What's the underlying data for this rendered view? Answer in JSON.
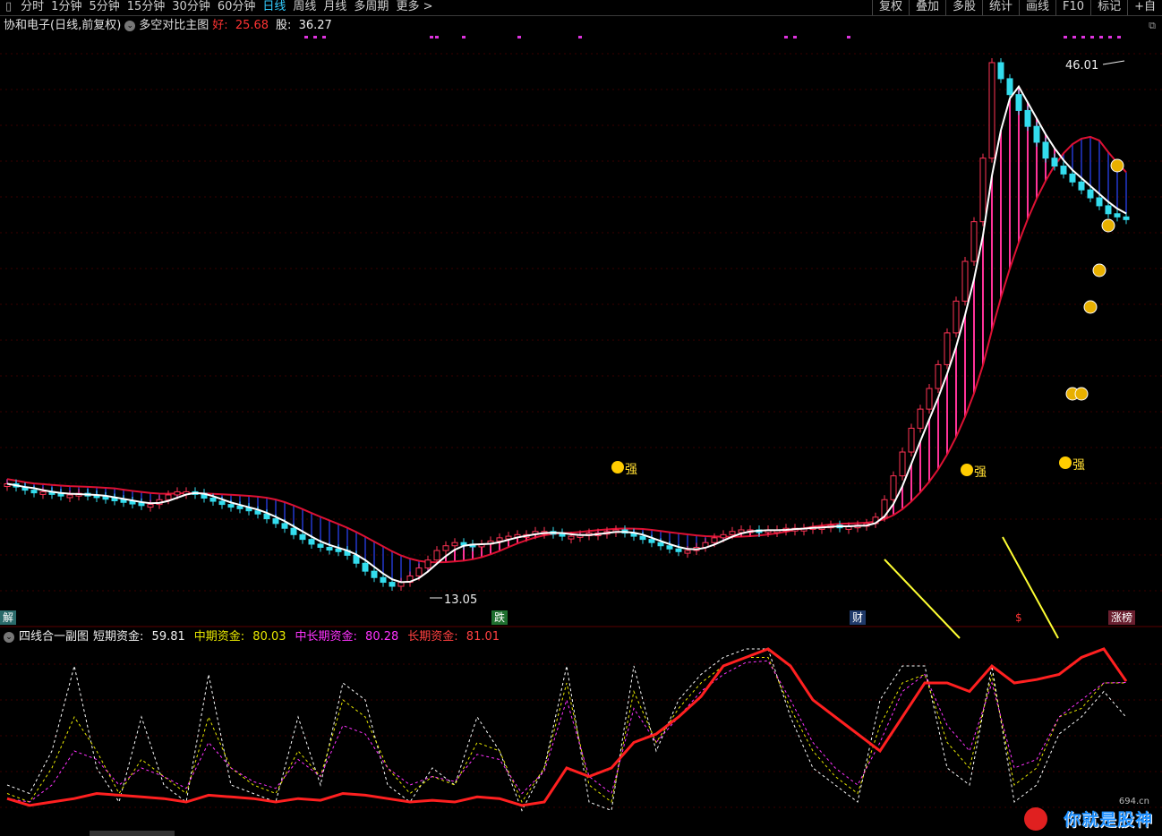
{
  "toolbar": {
    "tabs": [
      "分时",
      "1分钟",
      "5分钟",
      "15分钟",
      "30分钟",
      "60分钟",
      "日线",
      "周线",
      "月线",
      "多周期",
      "更多 >"
    ],
    "active_tab": "日线",
    "right_buttons": [
      "复权",
      "叠加",
      "多股",
      "统计",
      "画线",
      "F10",
      "标记",
      "+自"
    ]
  },
  "main_header": {
    "stock": "协和电子(日线,前复权)",
    "indicator": "多空对比主图",
    "good_label": "好:",
    "good_value": "25.68",
    "stock_label": "股:",
    "stock_value": "36.27"
  },
  "sub_header": {
    "indicator": "四线合一副图",
    "short_label": "短期资金:",
    "short_value": "59.81",
    "mid_label": "中期资金:",
    "mid_value": "80.03",
    "midlong_label": "中长期资金:",
    "midlong_value": "80.28",
    "long_label": "长期资金:",
    "long_value": "81.01"
  },
  "event_labels": {
    "left": "解",
    "die": "跌",
    "cai": "财",
    "dollar": "$",
    "zhang": "涨榜"
  },
  "chart_labels": {
    "high": "46.01",
    "low": "13.05",
    "strong": "强"
  },
  "watermark": {
    "site": "694.cn",
    "text": "你就是股神"
  },
  "colors": {
    "bull": "#ff3355",
    "bear": "#33ddee",
    "fill_bear": "#1a2a9a",
    "fill_bull": "#ff3399",
    "ma": "#ffffff",
    "resist": "#dd1133",
    "short": "#ffffff",
    "mid": "#e8e800",
    "midlong": "#ff33ff",
    "long": "#ff2020"
  },
  "chart_data": [
    {
      "type": "candlestick",
      "title": "多空对比主图",
      "series": [
        {
          "name": "价格K线",
          "x": [
            0,
            10,
            20,
            30,
            40,
            50,
            60,
            70,
            80,
            90,
            100,
            110,
            120,
            130,
            140,
            150,
            160,
            170,
            180,
            190,
            200,
            210,
            220,
            230,
            240,
            250,
            260,
            270,
            280,
            290,
            300,
            310,
            320,
            330,
            340,
            350,
            360,
            370,
            380,
            390,
            400,
            410,
            420,
            430,
            440,
            450,
            460,
            470,
            480,
            490,
            500,
            510,
            520,
            530,
            540,
            550,
            560,
            570,
            580,
            590,
            600,
            610,
            620,
            630,
            640,
            650,
            660,
            670,
            680,
            690,
            700,
            710,
            720,
            730,
            740,
            750,
            760,
            770,
            780,
            790,
            800,
            810,
            820,
            830,
            840,
            850,
            860,
            870,
            880,
            890,
            900,
            910,
            920,
            930,
            940,
            950,
            960,
            970,
            980,
            990,
            1000,
            1010,
            1020,
            1030,
            1040,
            1050,
            1060,
            1070,
            1080,
            1090,
            1100,
            1110,
            1120,
            1130,
            1140,
            1150,
            1160,
            1170,
            1180,
            1190,
            1200,
            1210,
            1220,
            1230,
            1240,
            1250
          ],
          "close": [
            19.5,
            19.3,
            19.1,
            19.0,
            19.0,
            18.9,
            18.8,
            18.8,
            18.9,
            18.8,
            18.7,
            18.6,
            18.5,
            18.4,
            18.3,
            18.2,
            18.2,
            18.5,
            18.8,
            19.0,
            19.0,
            18.9,
            18.6,
            18.4,
            18.2,
            18.1,
            18.0,
            17.8,
            17.6,
            17.3,
            17.0,
            16.7,
            16.3,
            16.0,
            15.7,
            15.5,
            15.4,
            15.3,
            15.0,
            14.5,
            14.0,
            13.6,
            13.3,
            13.05,
            13.3,
            13.7,
            14.2,
            14.7,
            15.3,
            15.6,
            15.8,
            15.7,
            15.6,
            15.7,
            15.9,
            16.1,
            16.2,
            16.3,
            16.3,
            16.5,
            16.5,
            16.4,
            16.2,
            16.2,
            16.3,
            16.4,
            16.4,
            16.5,
            16.6,
            16.4,
            16.2,
            16.0,
            15.8,
            15.6,
            15.4,
            15.3,
            15.3,
            15.5,
            15.8,
            16.1,
            16.3,
            16.5,
            16.6,
            16.6,
            16.5,
            16.6,
            16.6,
            16.7,
            16.7,
            16.7,
            16.8,
            16.8,
            16.9,
            16.8,
            16.8,
            16.9,
            17.0,
            17.4,
            18.5,
            20.0,
            21.5,
            23.0,
            24.2,
            25.5,
            27.0,
            29.0,
            31.0,
            33.5,
            36.0,
            40.0,
            46.01,
            45.0,
            44.0,
            43.0,
            42.0,
            41.0,
            40.0,
            39.5,
            39.0,
            38.5,
            38.0,
            37.5,
            37.0,
            36.5,
            36.3,
            36.27
          ]
        }
      ],
      "annotations": [
        "46.01",
        "13.05",
        "强"
      ],
      "y_label": "",
      "x_label": ""
    },
    {
      "type": "line",
      "title": "四线合一副图",
      "ylim": [
        0,
        100
      ],
      "series": [
        {
          "name": "短期资金",
          "values": [
            20,
            15,
            40,
            90,
            30,
            10,
            60,
            20,
            10,
            85,
            20,
            15,
            10,
            60,
            20,
            80,
            70,
            20,
            10,
            30,
            20,
            60,
            40,
            5,
            30,
            90,
            10,
            5,
            90,
            40,
            70,
            85,
            95,
            100,
            100,
            60,
            30,
            20,
            10,
            70,
            90,
            90,
            30,
            20,
            90,
            10,
            20,
            50,
            60,
            75,
            59.81
          ]
        },
        {
          "name": "中期资金",
          "values": [
            15,
            10,
            30,
            60,
            40,
            15,
            35,
            25,
            15,
            60,
            30,
            20,
            15,
            40,
            25,
            70,
            60,
            30,
            15,
            25,
            20,
            45,
            40,
            10,
            30,
            80,
            20,
            10,
            75,
            45,
            65,
            80,
            90,
            95,
            95,
            65,
            40,
            25,
            15,
            55,
            80,
            85,
            45,
            30,
            85,
            20,
            30,
            60,
            65,
            80,
            80.03
          ]
        },
        {
          "name": "中长期资金",
          "values": [
            12,
            10,
            20,
            40,
            35,
            20,
            30,
            25,
            18,
            45,
            30,
            22,
            18,
            35,
            25,
            55,
            50,
            30,
            20,
            25,
            22,
            38,
            35,
            15,
            28,
            70,
            25,
            15,
            65,
            45,
            60,
            75,
            85,
            92,
            93,
            70,
            45,
            30,
            20,
            45,
            75,
            85,
            55,
            40,
            80,
            30,
            35,
            60,
            70,
            80,
            80.28
          ]
        },
        {
          "name": "长期资金",
          "values": [
            12,
            8,
            10,
            12,
            15,
            14,
            13,
            12,
            10,
            14,
            13,
            12,
            10,
            12,
            11,
            15,
            14,
            12,
            10,
            11,
            10,
            13,
            12,
            8,
            10,
            30,
            25,
            30,
            45,
            50,
            60,
            72,
            90,
            95,
            100,
            90,
            70,
            60,
            50,
            40,
            60,
            80,
            80,
            75,
            90,
            80,
            82,
            85,
            95,
            100,
            81.01
          ]
        }
      ]
    }
  ]
}
